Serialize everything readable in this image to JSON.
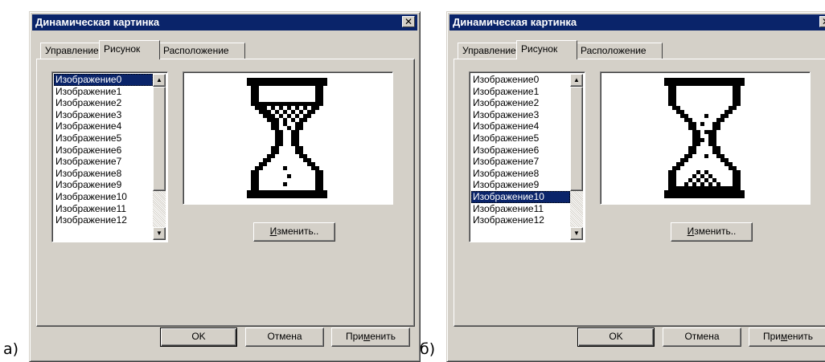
{
  "figures": [
    {
      "label": "а)",
      "title": "Динамическая картинка",
      "close_glyph": "✕",
      "tabs": [
        "Управление",
        "Рисунок",
        "Расположение"
      ],
      "active_tab": 1,
      "items": [
        "Изображение0",
        "Изображение1",
        "Изображение2",
        "Изображение3",
        "Изображение4",
        "Изображение5",
        "Изображение6",
        "Изображение7",
        "Изображение8",
        "Изображение9",
        "Изображение10",
        "Изображение11",
        "Изображение12"
      ],
      "selected_index": 0,
      "change_button": {
        "mnemonic": "И",
        "rest": "зменить.."
      },
      "hourglass_state": "sand-top",
      "ok_label": "OK",
      "cancel_label": "Отмена",
      "apply_button": {
        "before": "При",
        "mnemonic": "м",
        "after": "енить"
      }
    },
    {
      "label": "б)",
      "title": "Динамическая картинка",
      "close_glyph": "✕",
      "tabs": [
        "Управление",
        "Рисунок",
        "Расположение"
      ],
      "active_tab": 1,
      "items": [
        "Изображение0",
        "Изображение1",
        "Изображение2",
        "Изображение3",
        "Изображение4",
        "Изображение5",
        "Изображение6",
        "Изображение7",
        "Изображение8",
        "Изображение9",
        "Изображение10",
        "Изображение11",
        "Изображение12"
      ],
      "selected_index": 10,
      "change_button": {
        "mnemonic": "И",
        "rest": "зменить.."
      },
      "hourglass_state": "sand-bottom",
      "ok_label": "OK",
      "cancel_label": "Отмена",
      "apply_button": {
        "before": "При",
        "mnemonic": "м",
        "after": "енить"
      }
    }
  ],
  "colors": {
    "titlebar": "#0a246a",
    "face": "#d4d0c8",
    "selection": "#0a246a"
  },
  "icons": {
    "close": "close-icon",
    "scroll_up": "arrow-up-icon",
    "scroll_down": "arrow-down-icon",
    "preview": "hourglass-icon"
  }
}
